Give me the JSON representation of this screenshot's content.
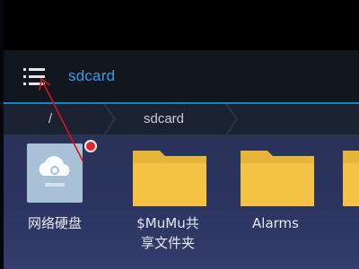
{
  "app_bar": {
    "title": "sdcard",
    "menu_icon": "menu-icon"
  },
  "breadcrumb": {
    "items": [
      "/",
      "sdcard"
    ]
  },
  "files": [
    {
      "label": "网络硬盘",
      "icon": "cloud-drive-icon",
      "badge": true
    },
    {
      "label": "$MuMu共享文件夹",
      "label_line1": "$MuMu共",
      "label_line2": "享文件夹",
      "icon": "folder-icon"
    },
    {
      "label": "Alarms",
      "icon": "folder-icon"
    }
  ],
  "colors": {
    "accent": "#2f9ee6",
    "folder": "#f4c244",
    "badge": "#e8242e",
    "annotation_arrow": "#d2121e"
  }
}
